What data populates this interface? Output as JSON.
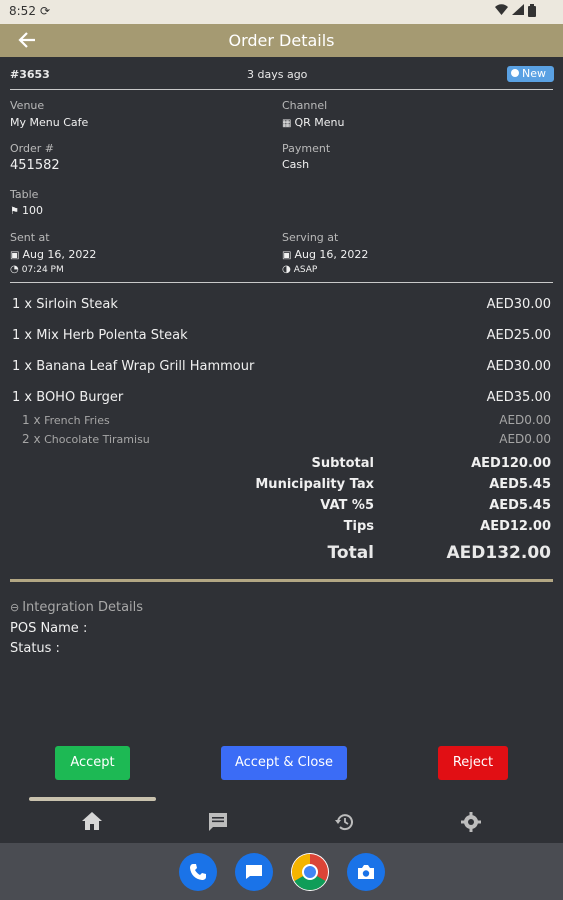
{
  "status_bar": {
    "time": "8:52",
    "icons": [
      "sync-icon",
      "wifi-icon",
      "signal-icon",
      "battery-icon"
    ]
  },
  "app_bar": {
    "title": "Order Details",
    "back_icon": "arrow-left-icon"
  },
  "order": {
    "id": "#3653",
    "time_ago": "3 days ago",
    "badge": "New",
    "venue_label": "Venue",
    "venue": "My Menu Cafe",
    "channel_label": "Channel",
    "channel": "QR Menu",
    "order_no_label": "Order #",
    "order_no": "451582",
    "payment_label": "Payment",
    "payment": "Cash",
    "table_label": "Table",
    "table": "100",
    "sent_label": "Sent at",
    "sent_date": "Aug 16, 2022",
    "sent_time": "07:24 PM",
    "serving_label": "Serving at",
    "serving_date": "Aug 16, 2022",
    "serving_time": "ASAP"
  },
  "items": [
    {
      "qty": "1 x",
      "name": "Sirloin Steak",
      "price": "AED30.00"
    },
    {
      "qty": "1 x",
      "name": "Mix Herb Polenta Steak",
      "price": "AED25.00"
    },
    {
      "qty": "1 x",
      "name": "Banana Leaf Wrap Grill Hammour",
      "price": "AED30.00"
    },
    {
      "qty": "1 x",
      "name": "BOHO Burger",
      "price": "AED35.00"
    }
  ],
  "sub_items": [
    {
      "qty": "1 x",
      "name": "French Fries",
      "price": "AED0.00"
    },
    {
      "qty": "2 x",
      "name": "Chocolate Tiramisu",
      "price": "AED0.00"
    }
  ],
  "summary": {
    "subtotal_label": "Subtotal",
    "subtotal": "AED120.00",
    "tax_label": "Municipality Tax",
    "tax": "AED5.45",
    "vat_label": "VAT %5",
    "vat": "AED5.45",
    "tips_label": "Tips",
    "tips": "AED12.00",
    "total_label": "Total",
    "total": "AED132.00"
  },
  "integration": {
    "title": "Integration Details",
    "pos_name": "POS Name :",
    "status": "Status :"
  },
  "actions": {
    "accept": "Accept",
    "accept_close": "Accept & Close",
    "reject": "Reject"
  },
  "tabs": [
    "home-icon",
    "message-icon",
    "history-icon",
    "settings-icon"
  ],
  "dock": [
    "phone-icon",
    "messages-icon",
    "chrome-icon",
    "camera-icon"
  ],
  "colors": {
    "accent": "#a59a72",
    "accept": "#1db954",
    "accept_close": "#3b6cf6",
    "reject": "#e10f14",
    "badge": "#5aa1e3"
  }
}
